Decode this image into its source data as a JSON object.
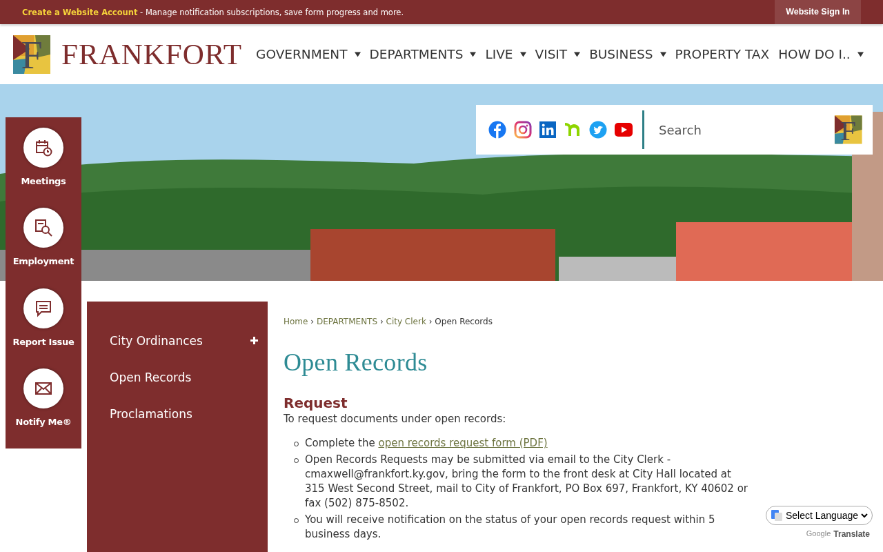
{
  "top_bar": {
    "account_link": "Create a Website Account",
    "account_text": "- Manage notification subscriptions, save form progress and more.",
    "sign_in": "Website Sign In"
  },
  "header": {
    "logo_mark": "F",
    "logo_text": "FRANKFORT",
    "nav": [
      {
        "label": "GOVERNMENT",
        "has_menu": true
      },
      {
        "label": "DEPARTMENTS",
        "has_menu": true
      },
      {
        "label": "LIVE",
        "has_menu": true
      },
      {
        "label": "VISIT",
        "has_menu": true
      },
      {
        "label": "BUSINESS",
        "has_menu": true
      },
      {
        "label": "PROPERTY TAX",
        "has_menu": false
      },
      {
        "label": "HOW DO I..",
        "has_menu": true
      }
    ]
  },
  "search": {
    "placeholder": "Search",
    "button_mark": "F"
  },
  "quick_links": [
    {
      "label": "Meetings"
    },
    {
      "label": "Employment"
    },
    {
      "label": "Report Issue"
    },
    {
      "label": "Notify Me®"
    }
  ],
  "subnav": {
    "items": [
      {
        "label": "City Ordinances",
        "expandable": true
      },
      {
        "label": "Open Records",
        "expandable": false
      },
      {
        "label": "Proclamations",
        "expandable": false
      }
    ]
  },
  "breadcrumb": {
    "separator": "›",
    "items": [
      {
        "label": "Home",
        "current": false
      },
      {
        "label": "DEPARTMENTS",
        "current": false
      },
      {
        "label": "City Clerk",
        "current": false
      },
      {
        "label": "Open Records",
        "current": true
      }
    ]
  },
  "content": {
    "title": "Open Records",
    "heading": "Request",
    "intro": "To request documents under open records:",
    "bullets": [
      {
        "text": "Complete the ",
        "link": "open records request form (PDF)"
      },
      {
        "text": "Open Records Requests may be submitted via email to the City Clerk - cmaxwell@frankfort.ky.gov, bring the form to the front desk at City Hall located at 315 West Second Street, mail to City of Frankfort, PO Box 697, Frankfort, KY  40602 or fax (502) 875-8502."
      },
      {
        "text": "You will receive notification on the status of your open records request within 5 business days."
      }
    ]
  },
  "translate": {
    "label": "Select Language",
    "brand": "Google",
    "text": "Translate"
  }
}
